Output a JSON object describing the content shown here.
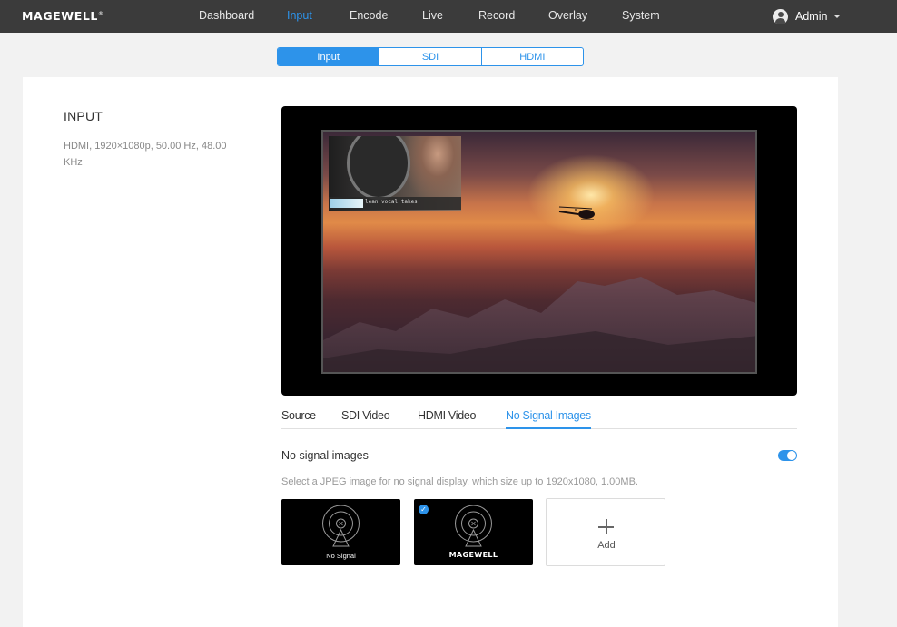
{
  "brand": {
    "logo": "MAGEWELL",
    "trademark": "®"
  },
  "nav": {
    "items": [
      "Dashboard",
      "Input",
      "Encode",
      "Live",
      "Record",
      "Overlay",
      "System"
    ],
    "active": "Input",
    "user": "Admin"
  },
  "segment_tabs": {
    "items": [
      "Input",
      "SDI",
      "HDMI"
    ],
    "active": "Input"
  },
  "section": {
    "title": "INPUT",
    "description": "HDMI, 1920×1080p, 50.00 Hz, 48.00 KHz"
  },
  "preview": {
    "pip_caption": "lean vocal takes!"
  },
  "sub_tabs": {
    "items": [
      "Source",
      "SDI Video",
      "HDMI Video",
      "No Signal Images"
    ],
    "active": "No Signal Images"
  },
  "no_signal": {
    "label": "No signal images",
    "enabled": true,
    "hint": "Select a JPEG image for no signal display, which size up to 1920x1080, 1.00MB.",
    "images": [
      {
        "caption": "No Signal",
        "selected": false,
        "icon": "no-signal-antenna-icon"
      },
      {
        "caption": "MAGEWELL",
        "selected": true,
        "icon": "no-signal-antenna-icon"
      }
    ],
    "add_label": "Add"
  },
  "colors": {
    "accent": "#2d93ea",
    "topbar": "#3b3b3b",
    "background": "#f2f2f2"
  }
}
